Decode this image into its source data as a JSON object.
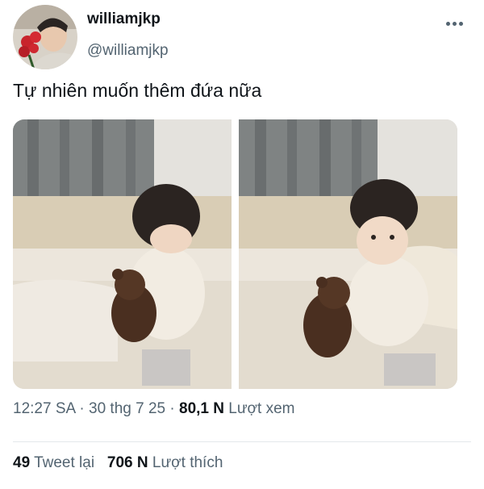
{
  "author": {
    "name": "williamjkp",
    "handle": "@williamjkp"
  },
  "tweet": {
    "text": "Tự nhiên muốn thêm đứa nữa"
  },
  "meta": {
    "time": "12:27 SA",
    "separator": "·",
    "date": "30 thg 7 25",
    "views_count": "80,1 N",
    "views_label": "Lượt xem"
  },
  "stats": {
    "retweets_count": "49",
    "retweets_label": "Tweet lại",
    "likes_count": "706 N",
    "likes_label": "Lượt thích"
  },
  "icons": {
    "more": "more-dots-icon"
  },
  "colors": {
    "text": "#0f1419",
    "secondary": "#536471",
    "divider": "#e4e8eb"
  }
}
